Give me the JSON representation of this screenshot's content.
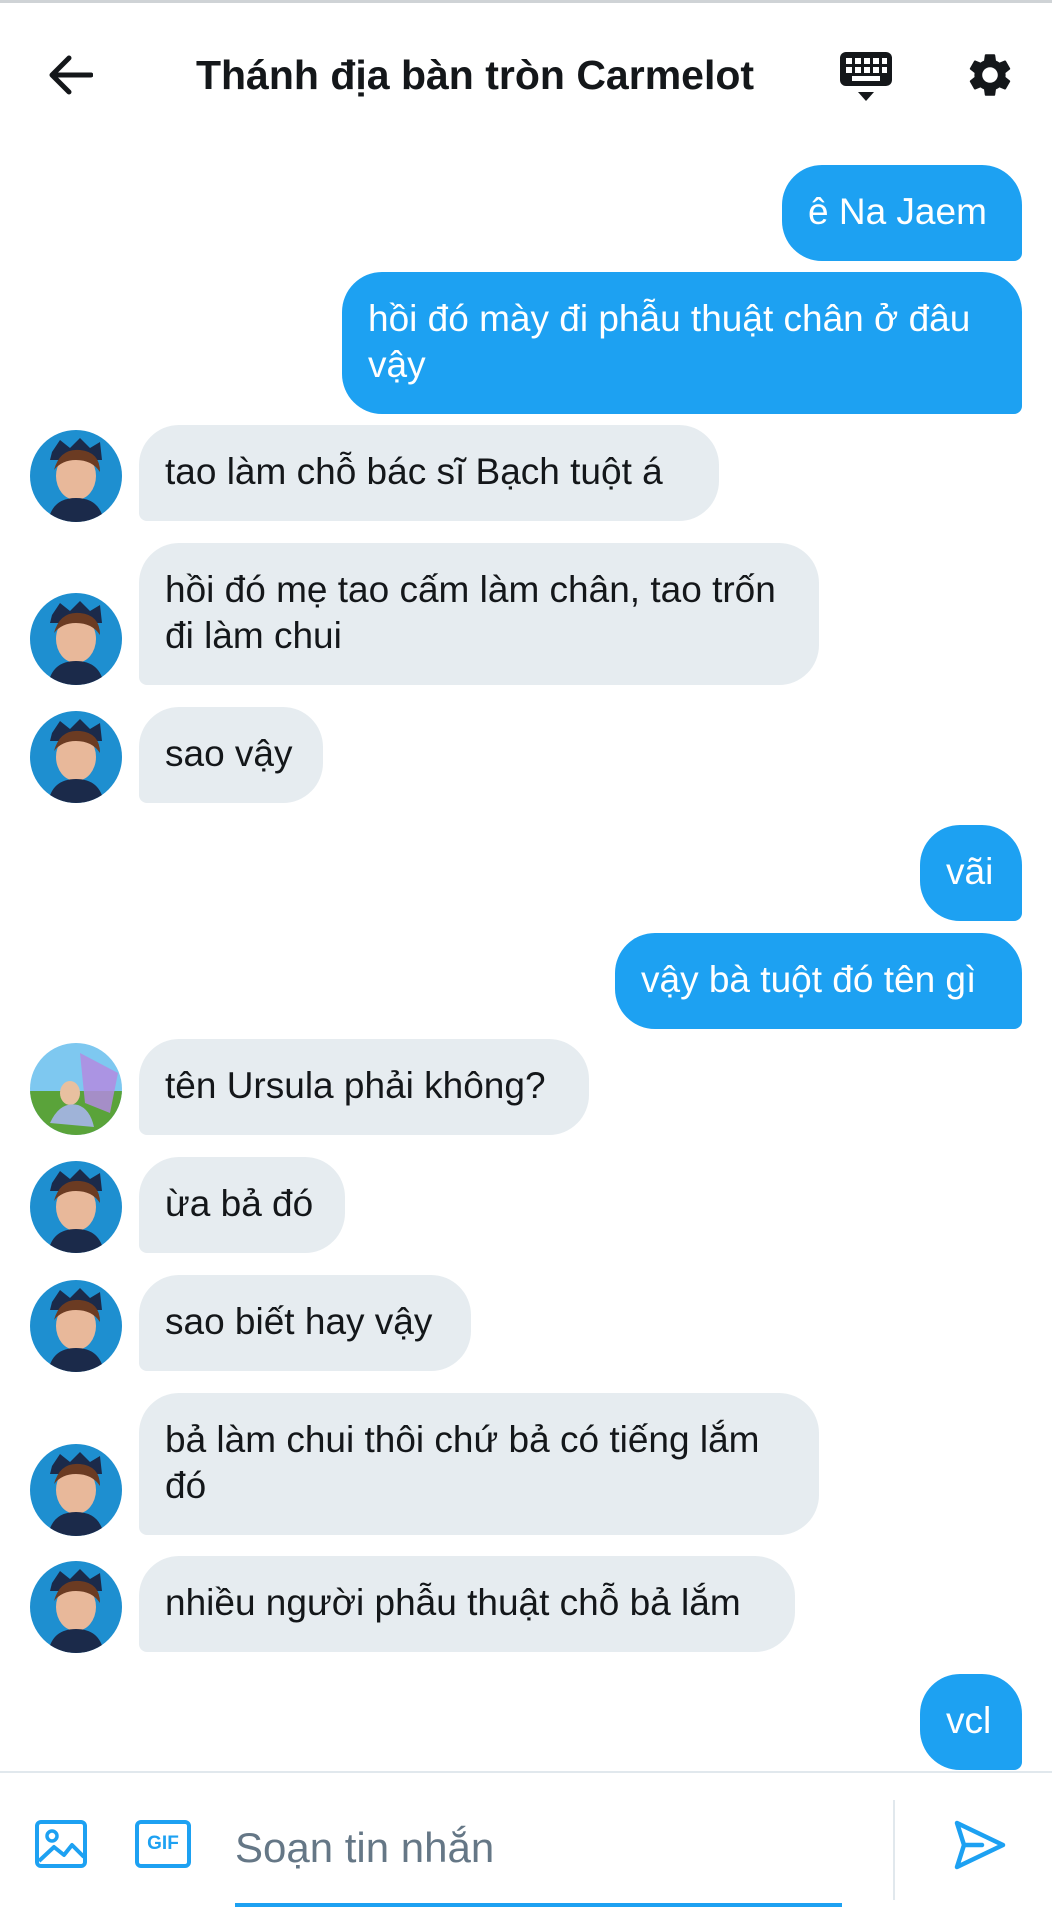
{
  "header": {
    "title": "Thánh địa bàn tròn Carmelot",
    "back_icon": "arrow-left-icon",
    "keyboard_icon": "keyboard-icon",
    "settings_icon": "gear-icon"
  },
  "messages": [
    {
      "direction": "out",
      "text": "ê Na Jaem"
    },
    {
      "direction": "out",
      "text": "hồi đó mày đi phẫu thuật chân ở đâu vậy"
    },
    {
      "direction": "in",
      "avatar": "avatar-a",
      "text": "tao làm chỗ bác sĩ Bạch tuột á"
    },
    {
      "direction": "in",
      "avatar": "avatar-a",
      "text": "hồi đó mẹ tao cấm làm chân, tao trốn đi làm chui"
    },
    {
      "direction": "in",
      "avatar": "avatar-a",
      "text": "sao vậy"
    },
    {
      "direction": "out",
      "text": "vãi"
    },
    {
      "direction": "out",
      "text": "vậy bà tuột đó tên gì"
    },
    {
      "direction": "in",
      "avatar": "avatar-b",
      "text": "tên Ursula phải không?"
    },
    {
      "direction": "in",
      "avatar": "avatar-a",
      "text": "ừa bả đó"
    },
    {
      "direction": "in",
      "avatar": "avatar-a",
      "text": "sao biết hay vậy"
    },
    {
      "direction": "in",
      "avatar": "avatar-a",
      "text": "bả làm chui thôi chứ bả có tiếng lắm đó"
    },
    {
      "direction": "in",
      "avatar": "avatar-a",
      "text": "nhiều người phẫu thuật chỗ bả lắm"
    },
    {
      "direction": "out",
      "text": "vcl"
    }
  ],
  "composer": {
    "placeholder": "Soạn tin nhắn",
    "value": "",
    "media_icon": "image-icon",
    "gif_label": "GIF",
    "send_icon": "send-icon"
  },
  "colors": {
    "accent": "#1da1f2",
    "incoming_bubble": "#e6ecf0",
    "text_primary": "#14171a",
    "text_secondary": "#657786"
  }
}
